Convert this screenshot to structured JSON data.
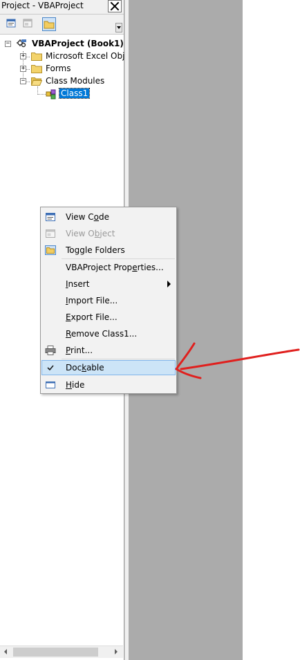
{
  "window": {
    "title": "Project - VBAProject"
  },
  "toolbar": {
    "buttons": [
      {
        "name": "view-code-icon"
      },
      {
        "name": "view-object-icon"
      },
      {
        "name": "toggle-folders-icon"
      }
    ]
  },
  "tree": {
    "root": "VBAProject (Book1)",
    "items": [
      {
        "label": "Microsoft Excel Obje"
      },
      {
        "label": "Forms"
      },
      {
        "label": "Class Modules"
      },
      {
        "label": "Class1"
      }
    ]
  },
  "context_menu": {
    "items": [
      {
        "pre": "View C",
        "u": "o",
        "post": "de",
        "enabled": true
      },
      {
        "pre": "View O",
        "u": "b",
        "post": "ject",
        "enabled": false
      },
      {
        "pre": "Toggle Folders",
        "u": "",
        "post": "",
        "enabled": true
      },
      {
        "pre": "VBAProject Prop",
        "u": "e",
        "post": "rties...",
        "enabled": true
      },
      {
        "pre": "",
        "u": "I",
        "post": "nsert",
        "enabled": true
      },
      {
        "pre": "",
        "u": "I",
        "post": "mport File...",
        "enabled": true
      },
      {
        "pre": "",
        "u": "E",
        "post": "xport File...",
        "enabled": true
      },
      {
        "pre": "",
        "u": "R",
        "post": "emove Class1...",
        "enabled": true
      },
      {
        "pre": "",
        "u": "P",
        "post": "rint...",
        "enabled": true
      },
      {
        "pre": "Doc",
        "u": "k",
        "post": "able",
        "enabled": true,
        "checked": true
      },
      {
        "pre": "",
        "u": "H",
        "post": "ide",
        "enabled": true
      }
    ]
  },
  "colors": {
    "annotation_arrow": "#e0201e",
    "selection": "#0078d7",
    "checked_bg": "#cce4f7",
    "grey_area": "#ababab"
  }
}
